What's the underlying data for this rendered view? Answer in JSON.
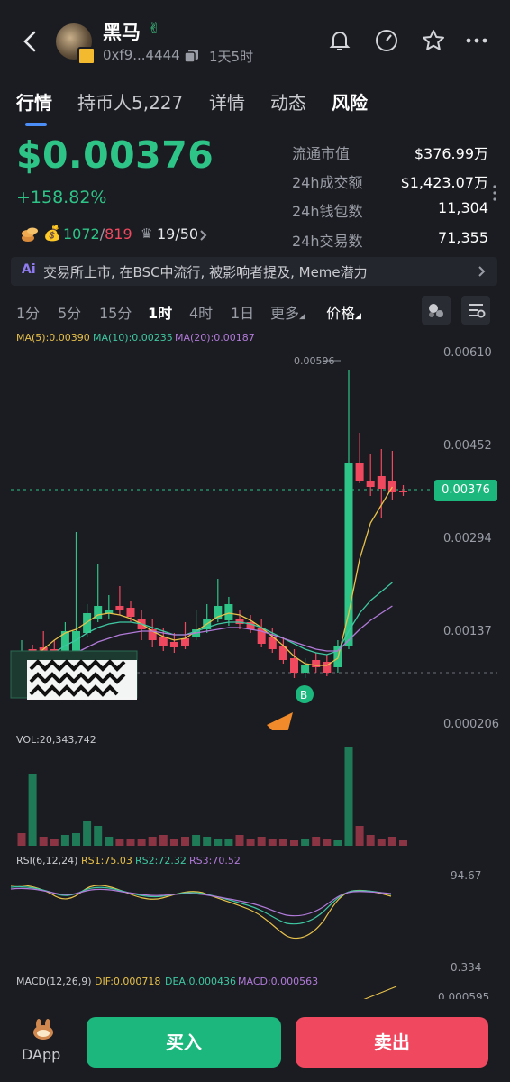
{
  "header": {
    "token_name": "黑马",
    "address": "0xf9...4444",
    "age": "1天5时"
  },
  "tabs": [
    {
      "label": "行情"
    },
    {
      "label": "持币人5,227"
    },
    {
      "label": "详情"
    },
    {
      "label": "动态"
    },
    {
      "label": "风险"
    }
  ],
  "price": {
    "value": "$0.00376",
    "change": "+158.82%"
  },
  "badges": {
    "buy_count": "1072",
    "slash": "/",
    "sell_count": "819",
    "rank": "19/50"
  },
  "stats": [
    {
      "label": "流通市值",
      "value": "$376.99万"
    },
    {
      "label": "24h成交额",
      "value": "$1,423.07万"
    },
    {
      "label": "24h钱包数",
      "value": "11,304"
    },
    {
      "label": "24h交易数",
      "value": "71,355"
    }
  ],
  "ai_banner": {
    "tag": "Ai",
    "text": "交易所上市, 在BSC中流行, 被影响者提及, Meme潜力"
  },
  "intervals": [
    "1分",
    "5分",
    "15分",
    "1时",
    "4时",
    "1日"
  ],
  "selected_interval": "1时",
  "more_label": "更多",
  "price_label": "价格",
  "ma": {
    "ma5": "MA(5):0.00390",
    "ma10": "MA(10):0.00235",
    "ma20": "MA(20):0.00187"
  },
  "y_axis": [
    "0.00610",
    "0.00452",
    "0.00294",
    "0.00137",
    "0.000206"
  ],
  "current_price_tag": "0.00376",
  "high_label": "0.00596",
  "buy_marker": "B",
  "vol_label": "VOL:20,343,742",
  "rsi": {
    "title": "RSI(6,12,24)",
    "rs1": "RS1:75.03",
    "rs2": "RS2:72.32",
    "rs3": "RS3:70.52",
    "top": "94.67",
    "bottom": "0.334"
  },
  "macd": {
    "title": "MACD(12,26,9)",
    "dif": "DIF:0.000718",
    "dea": "DEA:0.000436",
    "macd": "MACD:0.000563",
    "top": "0.000595"
  },
  "colors": {
    "up": "#2ec487",
    "down": "#f0485e",
    "ma5": "#e7c14a",
    "ma10": "#3ec7a2",
    "ma20": "#b17ad9",
    "accent": "#4b8ef7"
  },
  "bottom_bar": {
    "dapp_label": "DApp",
    "buy_label": "买入",
    "sell_label": "卖出"
  }
}
